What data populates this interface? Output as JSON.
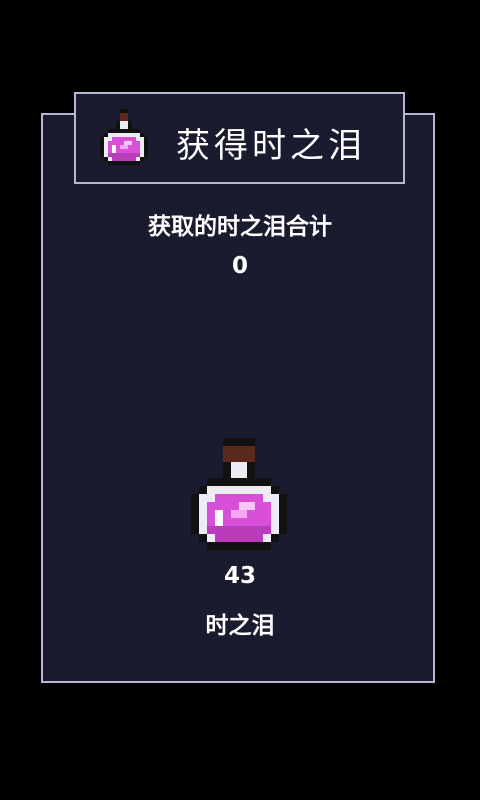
{
  "header": {
    "title": "获得时之泪",
    "icon": "potion-icon"
  },
  "summary": {
    "total_label": "获取的时之泪合计",
    "total_value": "0"
  },
  "reward": {
    "icon": "potion-icon",
    "count": "43",
    "name": "时之泪"
  },
  "colors": {
    "background": "#000000",
    "panel": "#1b1b2f",
    "border": "#b6b8cf",
    "potion": "#d84fd8",
    "potion_highlight": "#f0a8f0",
    "cork": "#5a2a1e"
  }
}
